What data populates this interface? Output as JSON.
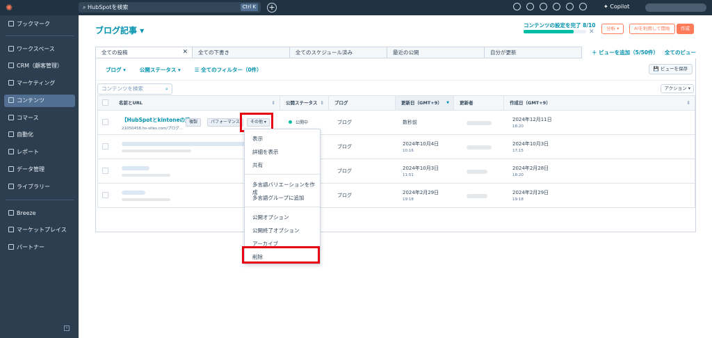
{
  "topbar": {
    "search_placeholder": "HubSpotを検索",
    "search_shortcut": "Ctrl K",
    "copilot_label": "Copilot"
  },
  "sidebar": {
    "items": [
      {
        "label": "ブックマーク",
        "icon": "bookmark-icon"
      },
      {
        "label": "ワークスペース",
        "icon": "workspace-icon"
      },
      {
        "label": "CRM（顧客管理）",
        "icon": "crm-icon"
      },
      {
        "label": "マーケティング",
        "icon": "marketing-icon"
      },
      {
        "label": "コンテンツ",
        "icon": "content-icon",
        "active": true
      },
      {
        "label": "コマース",
        "icon": "commerce-icon"
      },
      {
        "label": "自動化",
        "icon": "automation-icon"
      },
      {
        "label": "レポート",
        "icon": "report-icon"
      },
      {
        "label": "データ管理",
        "icon": "data-icon"
      },
      {
        "label": "ライブラリー",
        "icon": "library-icon"
      },
      {
        "label": "Breeze",
        "icon": "breeze-icon"
      },
      {
        "label": "マーケットプレイス",
        "icon": "marketplace-icon"
      },
      {
        "label": "パートナー",
        "icon": "partner-icon"
      }
    ]
  },
  "header": {
    "title": "ブログ記事 ▾",
    "setup_text": "コンテンツの設定を完了 8/10",
    "setup_progress": 0.8,
    "close_glyph": "✕",
    "analyze_label": "分析 ▾",
    "ai_label": "AIを利用して開始",
    "create_label": "作成"
  },
  "tabs": [
    {
      "label": "全ての投稿",
      "close": "✕"
    },
    {
      "label": "全ての下書き"
    },
    {
      "label": "全てのスケジュール済み"
    },
    {
      "label": "最近の公開"
    },
    {
      "label": "自分が更新"
    }
  ],
  "views": {
    "add_view": "＋ ビューを追加（5/50件）",
    "all_views": "全てのビュー"
  },
  "filters": {
    "blog": "ブログ ▾",
    "publish_status": "公開ステータス ▾",
    "all_filters": "☰ 全てのフィルター（0件）",
    "save_view": "💾 ビューを保存"
  },
  "table": {
    "search_placeholder": "コンテンツを検索",
    "actions_label": "アクション ▾",
    "columns": [
      "名前とURL",
      "公開ステータス",
      "ブログ",
      "更新日（GMT+9）",
      "更新者",
      "作成日（GMT+9）"
    ],
    "sort_glyph": "⇕",
    "sort_down_glyph": "▼",
    "rows": [
      {
        "title": "【HubSpotとkintoneの連...",
        "url": "21050458.hs-sites.com/ブログ...",
        "status": "公開中",
        "blog": "ブログ",
        "updated": "数秒前",
        "updated_time": "",
        "created": "2024年12月11日",
        "created_time": "18:20"
      },
      {
        "blog": "ブログ",
        "updated": "2024年10月4日",
        "updated_time": "10:16",
        "created": "2024年10月3日",
        "created_time": "17:15"
      },
      {
        "blog": "ブログ",
        "updated": "2024年10月3日",
        "updated_time": "11:51",
        "created": "2024年2月28日",
        "created_time": "18:20"
      },
      {
        "blog": "ブログ",
        "updated": "2024年2月29日",
        "updated_time": "19:18",
        "created": "2024年2月29日",
        "created_time": "19:18"
      }
    ],
    "row_buttons": {
      "copy": "複製",
      "performance": "パフォーマンス",
      "more": "その他 ▾"
    }
  },
  "dropdown": {
    "items": [
      "表示",
      "詳細を表示",
      "共有",
      "多言語バリエーションを作成",
      "多言語グループに追加",
      "公開オプション",
      "公開終了オプション",
      "アーカイブ",
      "削除"
    ]
  },
  "colors": {
    "highlight": "#e60012",
    "accent": "#0091ae",
    "brand": "#ff7a59"
  }
}
